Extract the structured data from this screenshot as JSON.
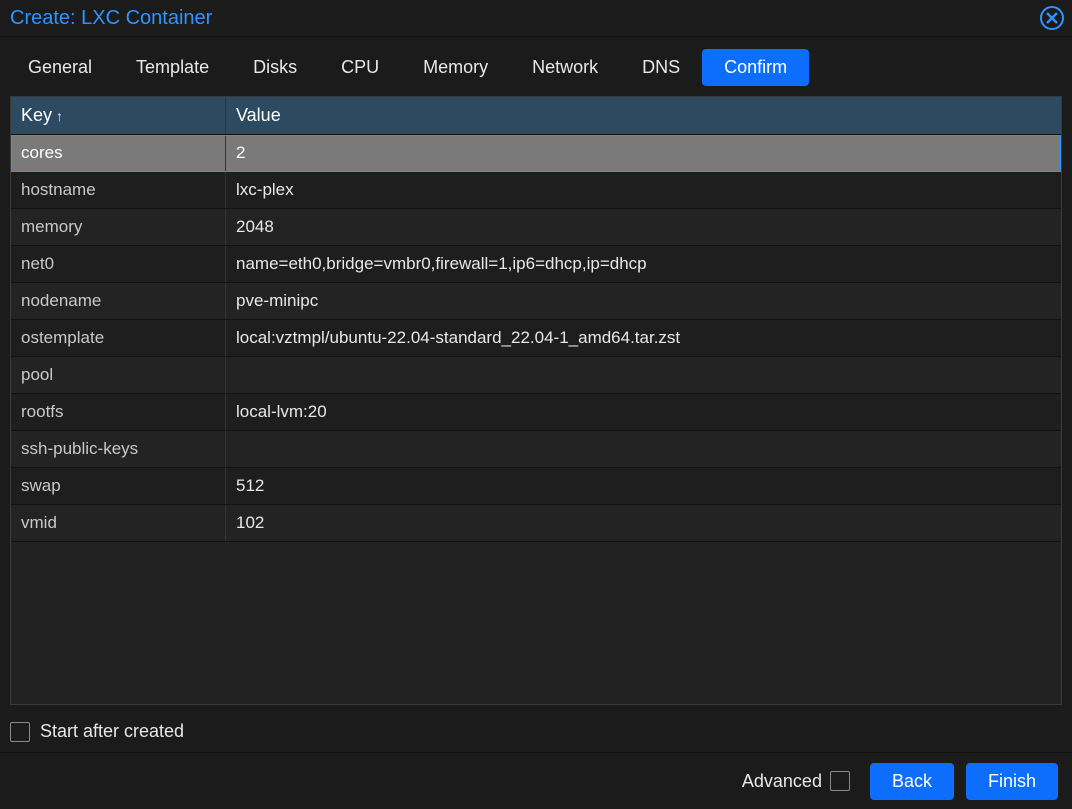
{
  "title": "Create: LXC Container",
  "tabs": [
    {
      "label": "General"
    },
    {
      "label": "Template"
    },
    {
      "label": "Disks"
    },
    {
      "label": "CPU"
    },
    {
      "label": "Memory"
    },
    {
      "label": "Network"
    },
    {
      "label": "DNS"
    },
    {
      "label": "Confirm",
      "active": true
    }
  ],
  "columns": {
    "key": "Key",
    "value": "Value",
    "sort_icon": "↑"
  },
  "rows": [
    {
      "key": "cores",
      "value": "2",
      "selected": true
    },
    {
      "key": "hostname",
      "value": "lxc-plex"
    },
    {
      "key": "memory",
      "value": "2048"
    },
    {
      "key": "net0",
      "value": "name=eth0,bridge=vmbr0,firewall=1,ip6=dhcp,ip=dhcp"
    },
    {
      "key": "nodename",
      "value": "pve-minipc"
    },
    {
      "key": "ostemplate",
      "value": "local:vztmpl/ubuntu-22.04-standard_22.04-1_amd64.tar.zst"
    },
    {
      "key": "pool",
      "value": ""
    },
    {
      "key": "rootfs",
      "value": "local-lvm:20"
    },
    {
      "key": "ssh-public-keys",
      "value": ""
    },
    {
      "key": "swap",
      "value": "512"
    },
    {
      "key": "vmid",
      "value": "102"
    }
  ],
  "start_after_created_label": "Start after created",
  "advanced_label": "Advanced",
  "back_label": "Back",
  "finish_label": "Finish"
}
